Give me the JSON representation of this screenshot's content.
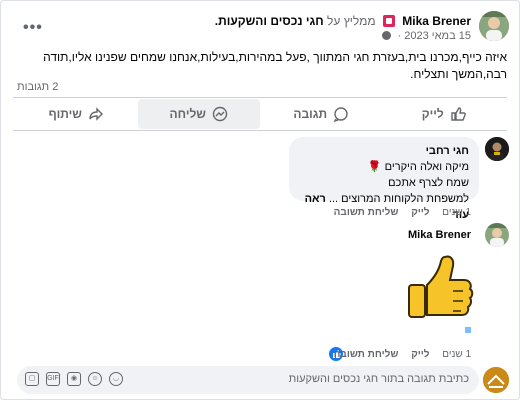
{
  "post": {
    "author": "Mika Brener",
    "recommends": "ממליץ על",
    "group_name": "חגי נכסים והשקעות.",
    "date": "15 במאי 2023",
    "text": "איזה כייף,מכרנו בית,בעזרת חגי   המתווך ,פעל במהירות,בעילות,אנחנו שמחים שפנינו אליו,תודה רבה,המשך ותצליח.",
    "comments_count": "2 תגובות"
  },
  "actions": {
    "like": "לייק",
    "comment": "תגובה",
    "send": "שליחה",
    "share": "שיתוף"
  },
  "comments": [
    {
      "author": "חגי רחבי",
      "line1": "מיקה ואלה היקרים",
      "line2": "שמח לצרף אתכם",
      "line3": "למשפחת הלקוחות המרוצים ...",
      "see_more": "ראה עוד",
      "time": "1 שנים",
      "like": "לייק",
      "reply": "שליחת תשובה"
    },
    {
      "author": "Mika Brener",
      "sticker": "thumbs-up-sticker",
      "time": "1 שנים",
      "like": "לייק",
      "reply": "שליחת תשובה"
    }
  ],
  "composer": {
    "placeholder": "כתיבת תגובה בתור חגי נכסים והשקעות"
  },
  "colors": {
    "brand_blue": "#1877f2",
    "muted": "#65676b",
    "bubble_bg": "#f0f2f5",
    "badge_red": "#e0245e"
  }
}
